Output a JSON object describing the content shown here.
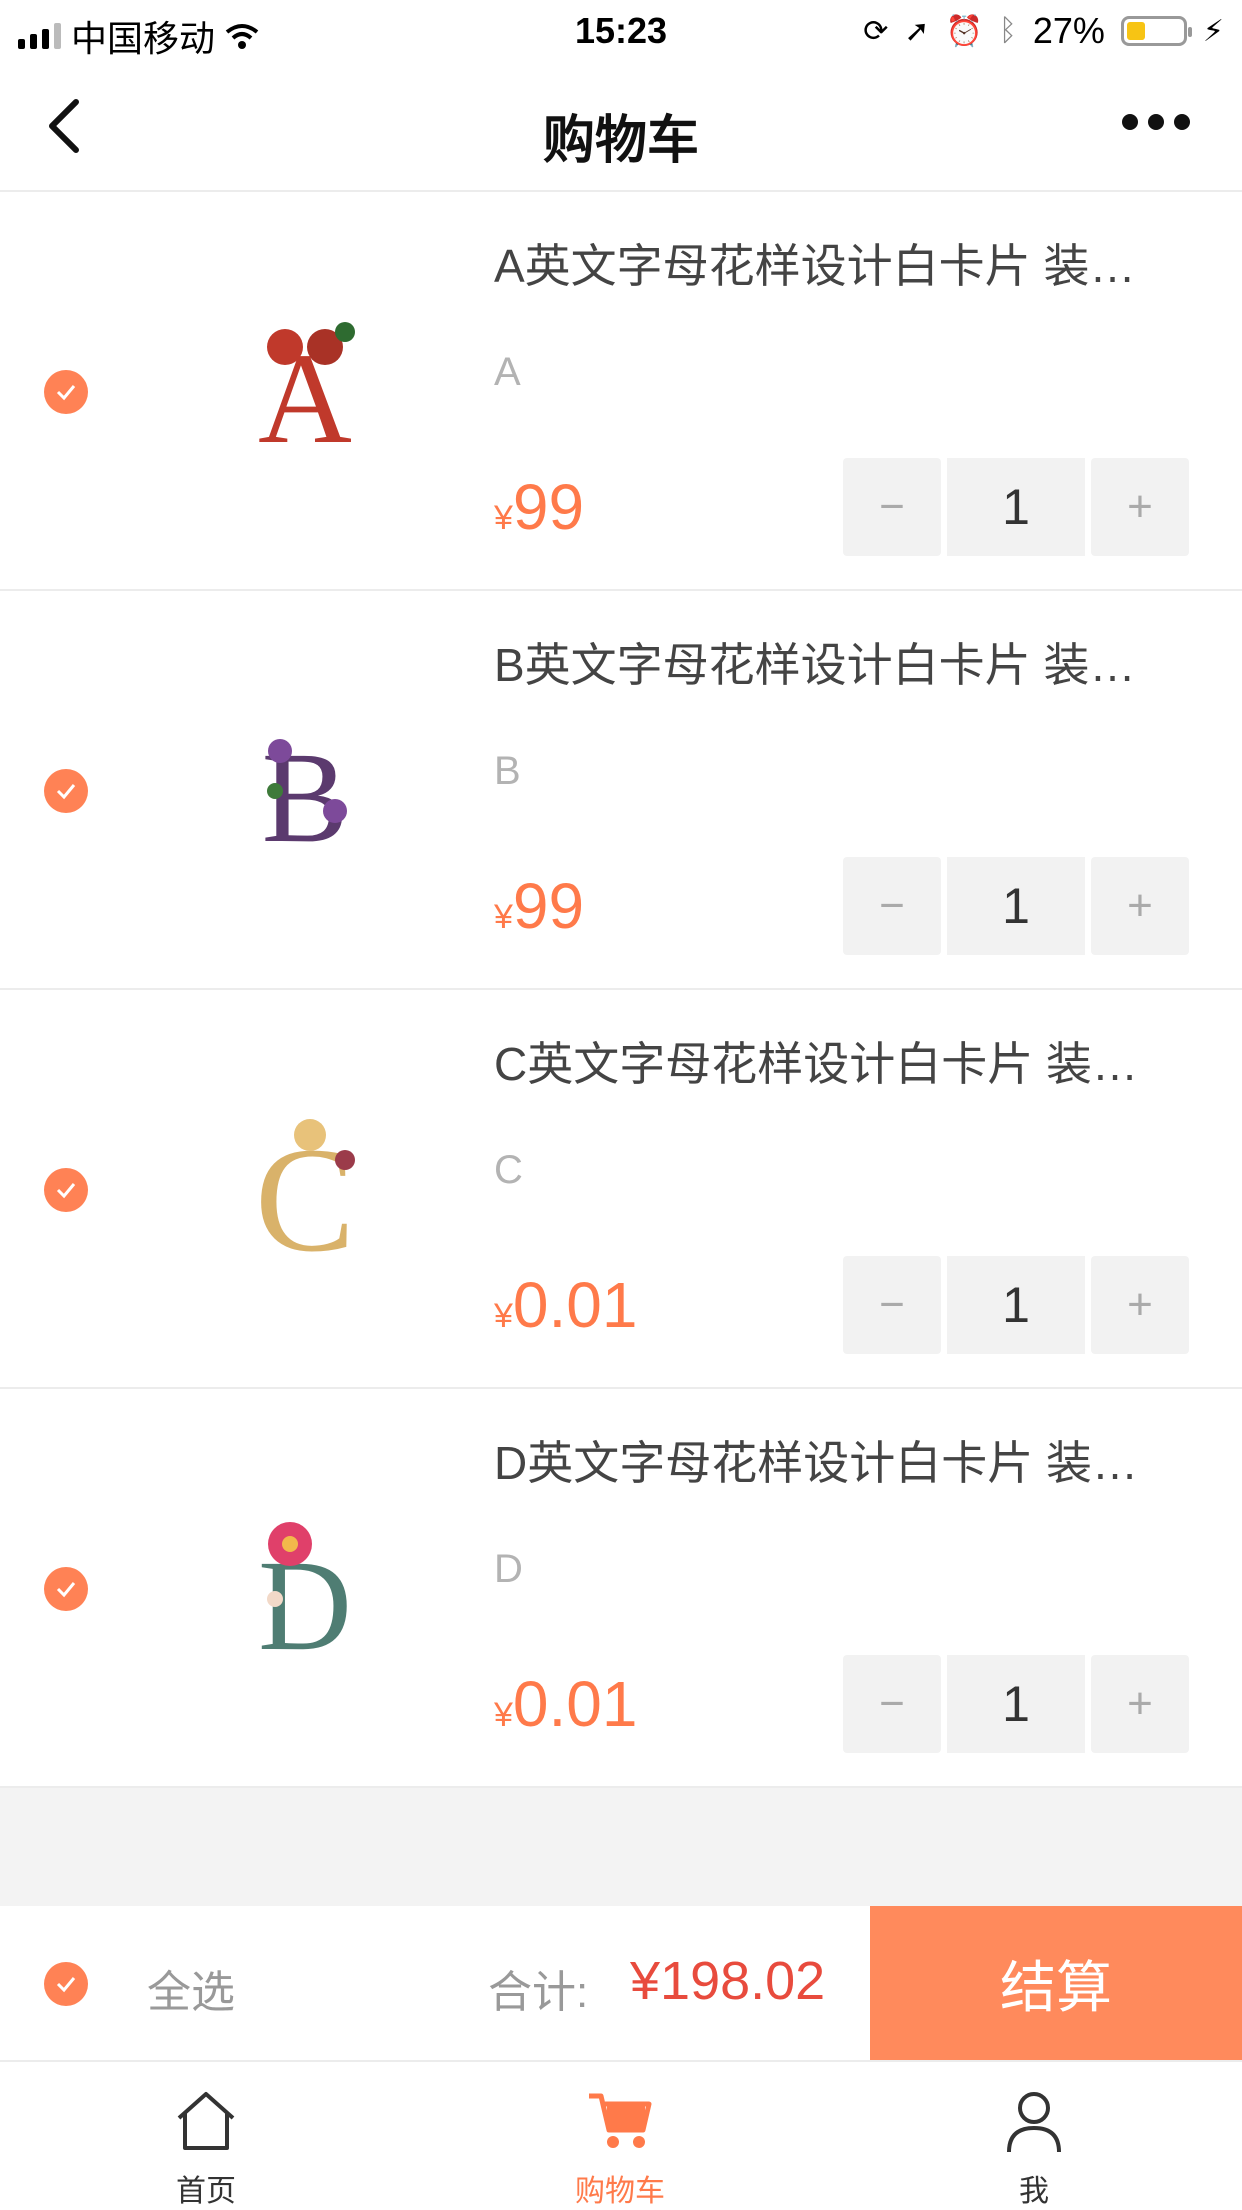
{
  "status_bar": {
    "carrier": "中国移动",
    "time": "15:23",
    "battery": "27%",
    "battery_level": 0.27
  },
  "nav": {
    "title": "购物车"
  },
  "cart": {
    "items": [
      {
        "name": "A英文字母花样设计白卡片 装…",
        "variant": "A",
        "currency": "¥",
        "price": "99",
        "qty": "1",
        "letter": "A",
        "image_color": "#c0392b"
      },
      {
        "name": "B英文字母花样设计白卡片 装…",
        "variant": "B",
        "currency": "¥",
        "price": "99",
        "qty": "1",
        "letter": "B",
        "image_color": "#5b3a6e"
      },
      {
        "name": "C英文字母花样设计白卡片 装…",
        "variant": "C",
        "currency": "¥",
        "price": "0.01",
        "qty": "1",
        "letter": "C",
        "image_color": "#d9b26a"
      },
      {
        "name": "D英文字母花样设计白卡片 装…",
        "variant": "D",
        "currency": "¥",
        "price": "0.01",
        "qty": "1",
        "letter": "D",
        "image_color": "#4f7d73"
      }
    ],
    "minus": "−",
    "plus": "+"
  },
  "summary": {
    "select_all": "全选",
    "total_label": "合计:",
    "total_value": "¥198.02",
    "checkout": "结算"
  },
  "tabs": [
    {
      "label": "首页",
      "icon": "home-icon",
      "color": "#333333"
    },
    {
      "label": "购物车",
      "icon": "cart-icon",
      "color": "#ff7a4a"
    },
    {
      "label": "我",
      "icon": "user-icon",
      "color": "#333333"
    }
  ],
  "colors": {
    "accent": "#ff8255",
    "price": "#ff7a4a",
    "total": "#e84b3d"
  }
}
